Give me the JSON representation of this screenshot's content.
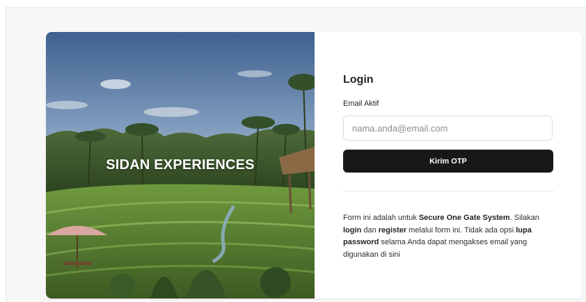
{
  "hero": {
    "title": "SIDAN EXPERIENCES",
    "image": "rice-terrace-landscape"
  },
  "form": {
    "title": "Login",
    "email_label": "Email Aktif",
    "email_placeholder": "nama.anda@email.com",
    "email_value": "",
    "submit_label": "Kirim OTP"
  },
  "info": {
    "t1": "Form ini adalah untuk ",
    "b1": "Secure One Gate System",
    "t2": ". Silakan ",
    "b2": "login",
    "t3": " dan ",
    "b3": "register",
    "t4": " melalui form ini. Tidak ada opsi ",
    "b4": "lupa password",
    "t5": " selama Anda dapat mengakses email yang digunakan di sini"
  },
  "colors": {
    "button_bg": "#17181a",
    "button_text": "#ffffff",
    "page_bg": "#f7f7f8"
  }
}
